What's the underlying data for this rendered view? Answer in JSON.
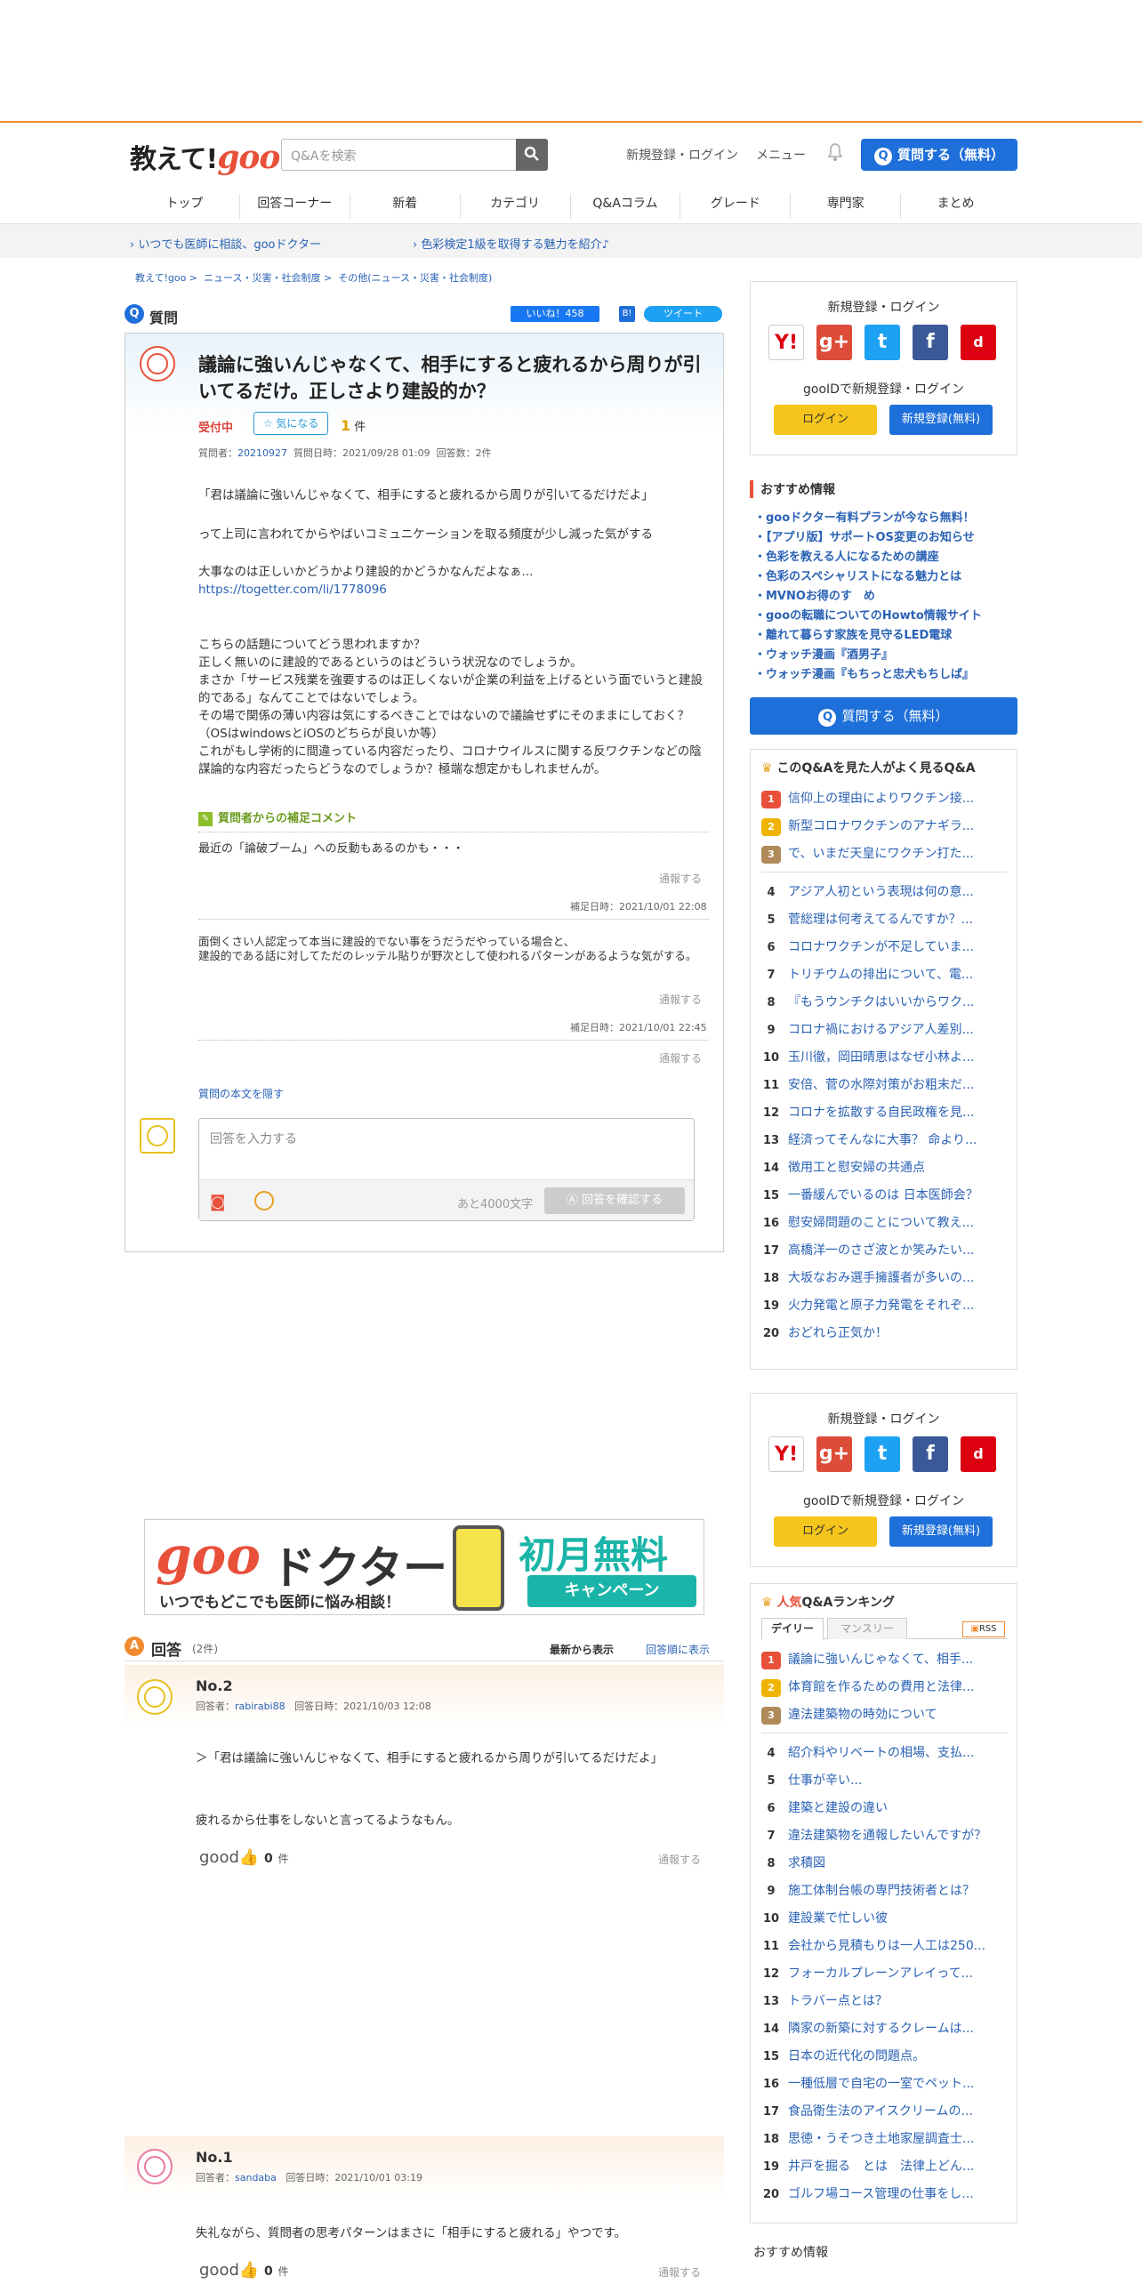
{
  "header": {
    "logo_text": "教えて!",
    "logo_goo": "goo",
    "search_placeholder": "Q&Aを検索",
    "signup_login": "新規登録・ログイン",
    "menu": "メニュー",
    "ask_button": "質問する（無料）",
    "nav": [
      "トップ",
      "回答コーナー",
      "新着",
      "カテゴリ",
      "Q&Aコラム",
      "グレード",
      "専門家",
      "まとめ"
    ]
  },
  "subbar": {
    "link1": "いつでも医師に相談、gooドクター",
    "link2": "色彩検定1級を取得する魅力を紹介♪"
  },
  "breadcrumb": [
    "教えて!goo",
    "ニュース・災害・社会制度",
    "その他(ニュース・災害・社会制度)"
  ],
  "question": {
    "section_label": "質問",
    "like_label": "いいね！458",
    "tweet_label": "ツイート",
    "title": "議論に強いんじゃなくて、相手にすると疲れるから周りが引いてるだけ。正しさより建設的か？",
    "status": "受付中",
    "watch_label": "気になる",
    "count_num": "1",
    "count_unit": "件",
    "meta_asker_label": "質問者：",
    "meta_asker": "20210927",
    "meta_date": "質問日時：2021/09/28 01:09",
    "meta_answers": "回答数：2件",
    "p1": "「君は議論に強いんじゃなくて、相手にすると疲れるから周りが引いてるだけだよ」",
    "p2": "って上司に言われてからやばいコミュニケーションを取る頻度が少し減った気がする",
    "p3": "大事なのは正しいかどうかより建設的かどうかなんだよなぁ...",
    "p3_link": "https://togetter.com/li/1778096",
    "p4": "こちらの話題についてどう思われますか？\n正しく無いのに建設的であるというのはどういう状況なのでしょうか。\nまさか「サービス残業を強要するのは正しくないが企業の利益を上げるという面でいうと建設的である」なんてことではないでしょう。\nその場で関係の薄い内容は気にするべきことではないので議論せずにそのままにしておく？（OSはwindowsとiOSのどちらが良いか等）\nこれがもし学術的に間違っている内容だったり、コロナウイルスに関する反ワクチンなどの陰謀論的な内容だったらどうなのでしょうか？極端な想定かもしれませんが。",
    "supp_heading": "質問者からの補足コメント",
    "supp1": "最近の「論破ブーム」への反動もあるのかも・・・",
    "report": "通報する",
    "supp1_date": "補足日時：2021/10/01 22:08",
    "supp2": "面倒くさい人認定って本当に建設的でない事をうだうだやっている場合と、\n建設的である話に対してただのレッテル貼りが野次として使われるパターンがあるような気がする。",
    "supp2_date": "補足日時：2021/10/01 22:45",
    "hide_link": "質問の本文を隠す",
    "answer_placeholder": "回答を入力する",
    "remaining": "あと4000文字",
    "confirm_button": "回答を確認する"
  },
  "ad": {
    "goo": "goo",
    "doctor": "ドクター",
    "sub": "いつでもどこでも医師に悩み相談！",
    "free": "初月無料",
    "campaign": "キャンペーン"
  },
  "answers_section": {
    "label": "回答",
    "count": "(2件)",
    "sort_new": "最新から表示",
    "sort_order": "回答順に表示",
    "good": "good",
    "good_count": "0",
    "good_unit": "件",
    "report": "通報する"
  },
  "answers": [
    {
      "no": "No.2",
      "answerer_label": "回答者：",
      "answerer": "rabirabi88",
      "date": "回答日時：2021/10/03 12:08",
      "text1": "＞「君は議論に強いんじゃなくて、相手にすると疲れるから周りが引いてるだけだよ」",
      "text2": "疲れるから仕事をしないと言ってるようなもん。"
    },
    {
      "no": "No.1",
      "answerer_label": "回答者：",
      "answerer": "sandaba",
      "date": "回答日時：2021/10/01 03:19",
      "text1": "失礼ながら、質問者の思考パターンはまさに「相手にすると疲れる」やつです。"
    }
  ],
  "login_box": {
    "title": "新規登録・ログイン",
    "icons": [
      "Y!",
      "g+",
      "t",
      "f",
      "d"
    ],
    "gooid": "gooIDで新規登録・ログイン",
    "login": "ログイン",
    "signup": "新規登録(無料)"
  },
  "recommend": {
    "title": "おすすめ情報",
    "items": [
      "・gooドクター有料プランが今なら無料！",
      "・【アプリ版】サポートOS変更のお知らせ",
      "・色彩を教える人になるための講座",
      "・色彩のスペシャリストになる魅力とは",
      "・MVNOお得のす　め",
      "・gooの転職についてのHowto情報サイト",
      "・離れて暮らす家族を見守るLED電球",
      "・ウォッチ漫画『酒男子』",
      "・ウォッチ漫画『もちっと忠犬もちしば』"
    ],
    "ask_button": "質問する（無料）"
  },
  "related": {
    "title": "このQ&Aを見た人がよく見るQ&A",
    "items": [
      "信仰上の理由によりワクチン接...",
      "新型コロナワクチンのアナギラ...",
      "で、いまだ天皇にワクチン打た...",
      "アジア人初という表現は何の意...",
      "菅総理は何考えてるんですか？...",
      "コロナワクチンが不足していま...",
      "トリチウムの排出について、電...",
      "『もうウンチクはいいからワク...",
      "コロナ禍におけるアジア人差別...",
      "玉川徹，岡田晴恵はなぜ小林よ...",
      "安倍、菅の水際対策がお粗末だ...",
      "コロナを拡散する自民政権を見...",
      "経済ってそんなに大事？ 命より...",
      "徴用工と慰安婦の共通点",
      "一番緩んでいるのは 日本医師会？",
      "慰安婦問題のことについて教え...",
      "高橋洋一のさざ波とか笑みたい...",
      "大坂なおみ選手擁護者が多いの...",
      "火力発電と原子力発電をそれぞ...",
      "おどれら正気か！"
    ]
  },
  "ranking": {
    "title_accent": "人気",
    "title_rest": "Q&Aランキング",
    "tab_daily": "デイリー",
    "tab_monthly": "マンスリー",
    "rss": "RSS",
    "items": [
      "議論に強いんじゃなくて、相手...",
      "体育館を作るための費用と法律...",
      "違法建築物の時効について",
      "紹介料やリベートの相場、支払...",
      "仕事が辛い...",
      "建築と建設の違い",
      "違法建築物を通報したいんですが？",
      "求積図",
      "施工体制台帳の専門技術者とは？",
      "建設業で忙しい彼",
      "会社から見積もりは一人工は250...",
      "フォーカルプレーンアレイって...",
      "トラバー点とは？",
      "隣家の新築に対するクレームは...",
      "日本の近代化の問題点。",
      "一種低層で自宅の一室でペット...",
      "食品衛生法のアイスクリームの...",
      "思徳・うそつき土地家屋調査士...",
      "井戸を掘る　とは　法律上どん...",
      "ゴルフ場コース管理の仕事をし..."
    ]
  },
  "recommend2_title": "おすすめ情報",
  "colors": {
    "accent": "#f08b30",
    "primary": "#1e6fd9",
    "red": "#e8503a",
    "link": "#2a62b5"
  }
}
